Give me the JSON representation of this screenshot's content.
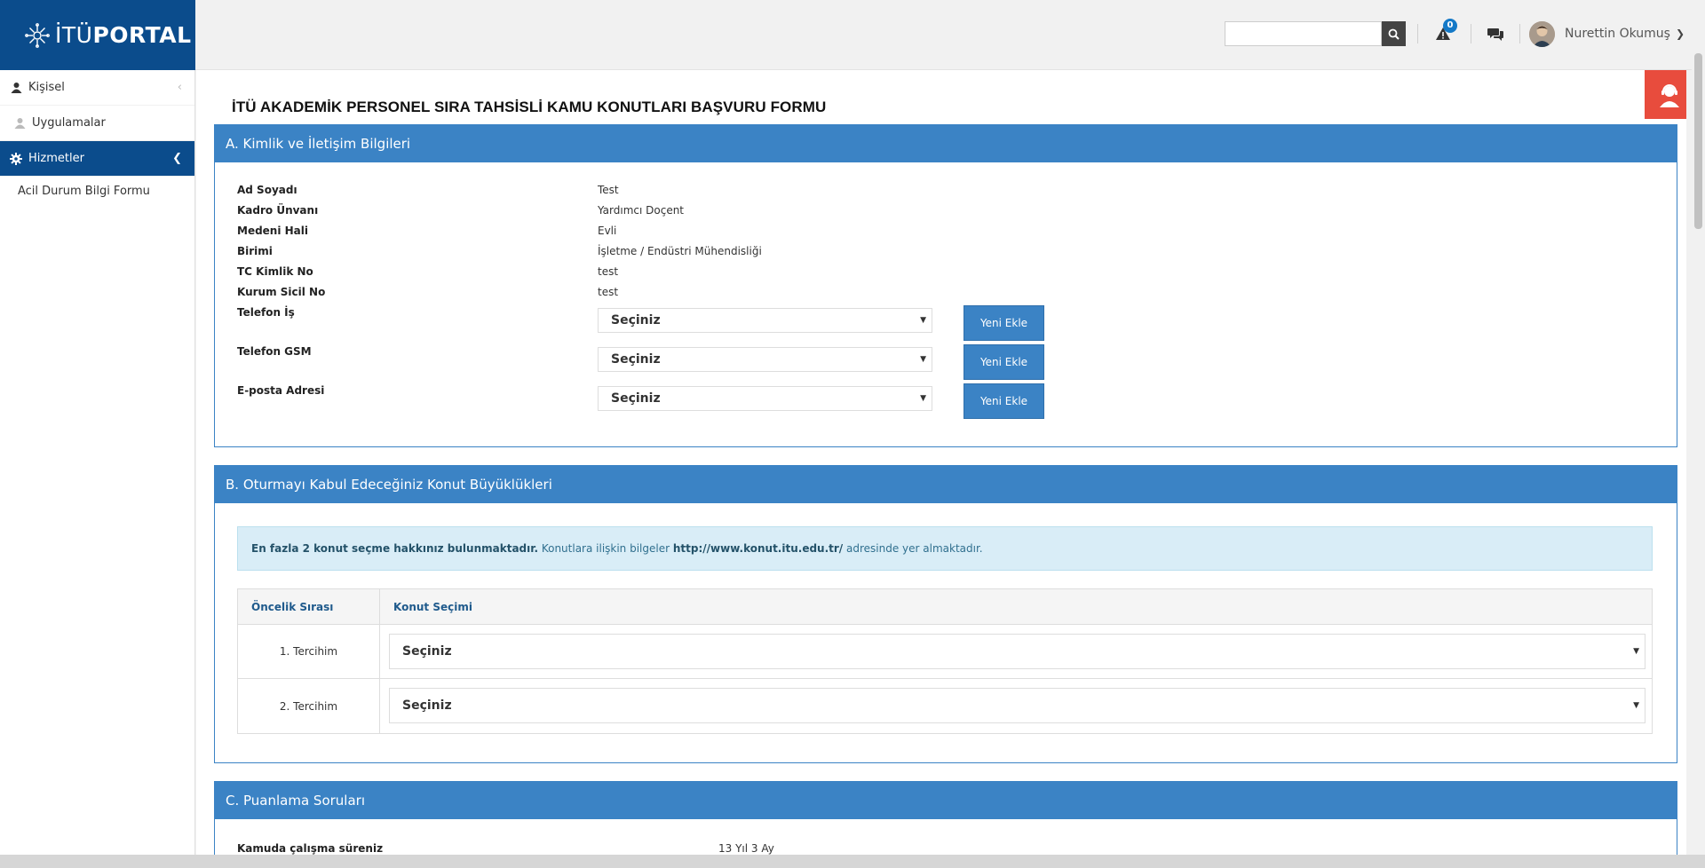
{
  "header": {
    "logo_prefix": "İTÜ",
    "logo_suffix": "PORTAL",
    "search_placeholder": "",
    "notification_count": "0",
    "user_name": "Nurettin Okumuş"
  },
  "sidebar": {
    "items": [
      {
        "label": "Kişisel",
        "icon": "user-icon"
      },
      {
        "label": "Uygulamalar",
        "icon": "user-outline-icon"
      },
      {
        "label": "Hizmetler",
        "icon": "gear-icon"
      }
    ],
    "subitems": [
      {
        "label": "Acil Durum Bilgi Formu"
      }
    ]
  },
  "page": {
    "title": "İTÜ AKADEMİK PERSONEL SIRA TAHSİSLİ KAMU KONUTLARI BAŞVURU FORMU"
  },
  "section_a": {
    "heading": "A. Kimlik ve İletişim Bilgileri",
    "fields": [
      {
        "label": "Ad Soyadı",
        "value": "Test"
      },
      {
        "label": "Kadro Ünvanı",
        "value": "Yardımcı Doçent"
      },
      {
        "label": "Medeni Hali",
        "value": "Evli"
      },
      {
        "label": "Birimi",
        "value": "İşletme / Endüstri Mühendisliği"
      },
      {
        "label": "TC Kimlik No",
        "value": "test"
      },
      {
        "label": "Kurum Sicil No",
        "value": "test"
      }
    ],
    "contacts": [
      {
        "label": "Telefon İş",
        "select": "Seçiniz",
        "button": "Yeni Ekle"
      },
      {
        "label": "Telefon GSM",
        "select": "Seçiniz",
        "button": "Yeni Ekle"
      },
      {
        "label": "E-posta Adresi",
        "select": "Seçiniz",
        "button": "Yeni Ekle"
      }
    ]
  },
  "section_b": {
    "heading": "B. Oturmayı Kabul Edeceğiniz Konut Büyüklükleri",
    "alert_bold": "En fazla 2 konut seçme hakkınız bulunmaktadır.",
    "alert_text1": " Konutlara ilişkin bilgeler ",
    "alert_link": "http://www.konut.itu.edu.tr/",
    "alert_text2": " adresinde yer almaktadır.",
    "table_headers": [
      "Öncelik Sırası",
      "Konut Seçimi"
    ],
    "rows": [
      {
        "priority": "1. Tercihim",
        "select": "Seçiniz"
      },
      {
        "priority": "2. Tercihim",
        "select": "Seçiniz"
      }
    ]
  },
  "section_c": {
    "heading": "C. Puanlama Soruları",
    "fields": [
      {
        "label": "Kamuda çalışma süreniz",
        "value": "13 Yıl 3 Ay"
      }
    ]
  },
  "colors": {
    "brand": "#0b4c8c",
    "panel_blue": "#3b83c5",
    "support_red": "#e84c3d",
    "alert_bg": "#d9edf7"
  }
}
